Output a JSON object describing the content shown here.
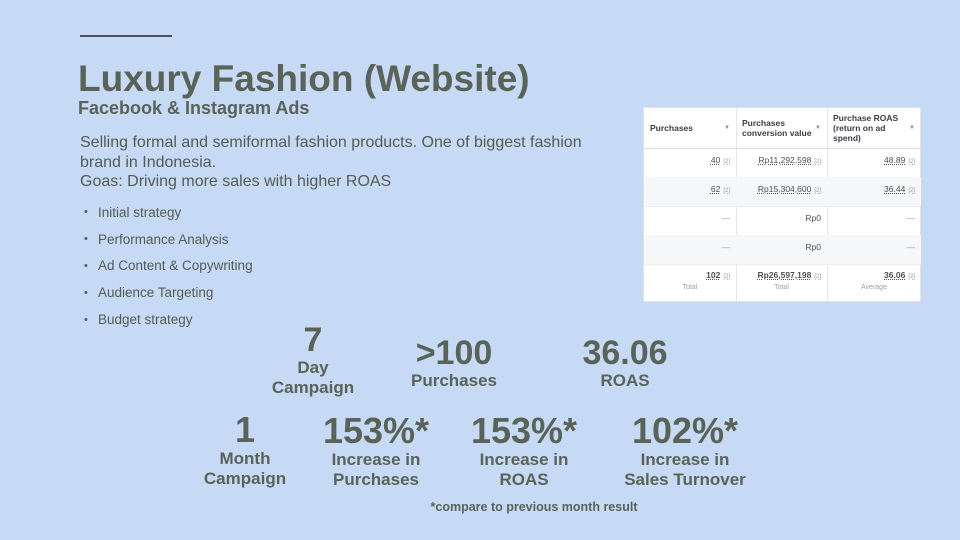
{
  "slide": {
    "title": "Luxury Fashion (Website)",
    "subtitle": "Facebook & Instagram Ads",
    "description": [
      "Selling formal and semiformal fashion products. One of biggest fashion",
      "brand in Indonesia.",
      "Goas: Driving more sales with higher ROAS"
    ],
    "bullets": [
      "Initial strategy",
      "Performance Analysis",
      "Ad Content & Copywriting",
      "Audience Targeting",
      "Budget strategy"
    ],
    "bullet_glyph": "•"
  },
  "table": {
    "headers": [
      "Purchases",
      "Purchases conversion value",
      "Purchase ROAS (return on ad spend)"
    ],
    "header_lines": [
      [
        "Purchases"
      ],
      [
        "Purchases",
        "conversion value"
      ],
      [
        "Purchase ROAS",
        "(return on ad",
        "spend)"
      ]
    ],
    "caret": "▼",
    "info_glyph": "[2]",
    "rows": [
      [
        "40",
        "Rp11,292,598",
        "48.89"
      ],
      [
        "62",
        "Rp15,304,600",
        "36.44"
      ],
      [
        "—",
        "Rp0",
        "—"
      ],
      [
        "—",
        "Rp0",
        "—"
      ]
    ],
    "totals": [
      "102",
      "Rp26,597,198",
      "36.06"
    ],
    "total_labels": [
      "Total",
      "Total",
      "Average"
    ]
  },
  "stats": {
    "day_campaign": {
      "value": "7",
      "label1": "Day",
      "label2": "Campaign"
    },
    "purchases": {
      "value": ">100",
      "label1": "Purchases"
    },
    "roas": {
      "value": "36.06",
      "label1": "ROAS"
    },
    "month_campaign": {
      "value": "1",
      "label1": "Month",
      "label2": "Campaign"
    },
    "inc_purchases": {
      "value": "153%*",
      "label1": "Increase in",
      "label2": "Purchases"
    },
    "inc_roas": {
      "value": "153%*",
      "label1": "Increase in",
      "label2": "ROAS"
    },
    "inc_sales": {
      "value": "102%*",
      "label1": "Increase in",
      "label2": "Sales Turnover"
    }
  },
  "footnote": "*compare to previous month result",
  "colors": {
    "background": "#c6d9f5",
    "text": "#5a6358"
  }
}
